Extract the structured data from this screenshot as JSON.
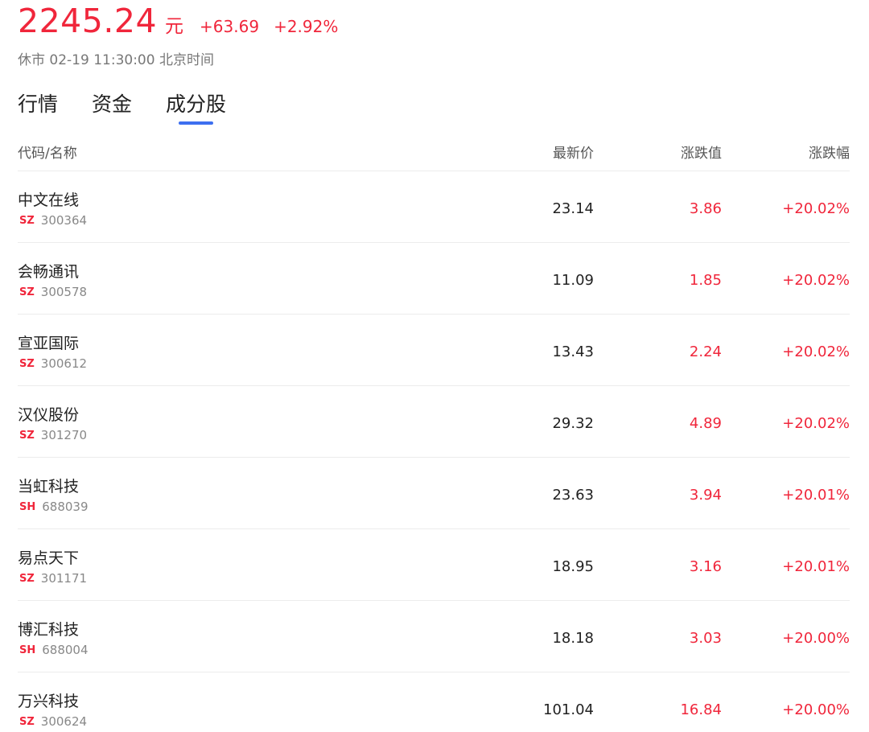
{
  "quote": {
    "price": "2245.24",
    "unit": "元",
    "change": "+63.69",
    "change_pct": "+2.92%"
  },
  "status": "休市 02-19 11:30:00 北京时间",
  "tabs": [
    {
      "label": "行情",
      "active": false
    },
    {
      "label": "资金",
      "active": false
    },
    {
      "label": "成分股",
      "active": true
    }
  ],
  "table": {
    "headers": {
      "name": "代码/名称",
      "price": "最新价",
      "change": "涨跌值",
      "change_pct": "涨跌幅"
    },
    "rows": [
      {
        "name": "中文在线",
        "market": "SZ",
        "code": "300364",
        "price": "23.14",
        "change": "3.86",
        "change_pct": "+20.02%"
      },
      {
        "name": "会畅通讯",
        "market": "SZ",
        "code": "300578",
        "price": "11.09",
        "change": "1.85",
        "change_pct": "+20.02%"
      },
      {
        "name": "宣亚国际",
        "market": "SZ",
        "code": "300612",
        "price": "13.43",
        "change": "2.24",
        "change_pct": "+20.02%"
      },
      {
        "name": "汉仪股份",
        "market": "SZ",
        "code": "301270",
        "price": "29.32",
        "change": "4.89",
        "change_pct": "+20.02%"
      },
      {
        "name": "当虹科技",
        "market": "SH",
        "code": "688039",
        "price": "23.63",
        "change": "3.94",
        "change_pct": "+20.01%"
      },
      {
        "name": "易点天下",
        "market": "SZ",
        "code": "301171",
        "price": "18.95",
        "change": "3.16",
        "change_pct": "+20.01%"
      },
      {
        "name": "博汇科技",
        "market": "SH",
        "code": "688004",
        "price": "18.18",
        "change": "3.03",
        "change_pct": "+20.00%"
      },
      {
        "name": "万兴科技",
        "market": "SZ",
        "code": "300624",
        "price": "101.04",
        "change": "16.84",
        "change_pct": "+20.00%"
      }
    ]
  },
  "colors": {
    "up": "#f0263b",
    "accent": "#3d6ff0"
  }
}
